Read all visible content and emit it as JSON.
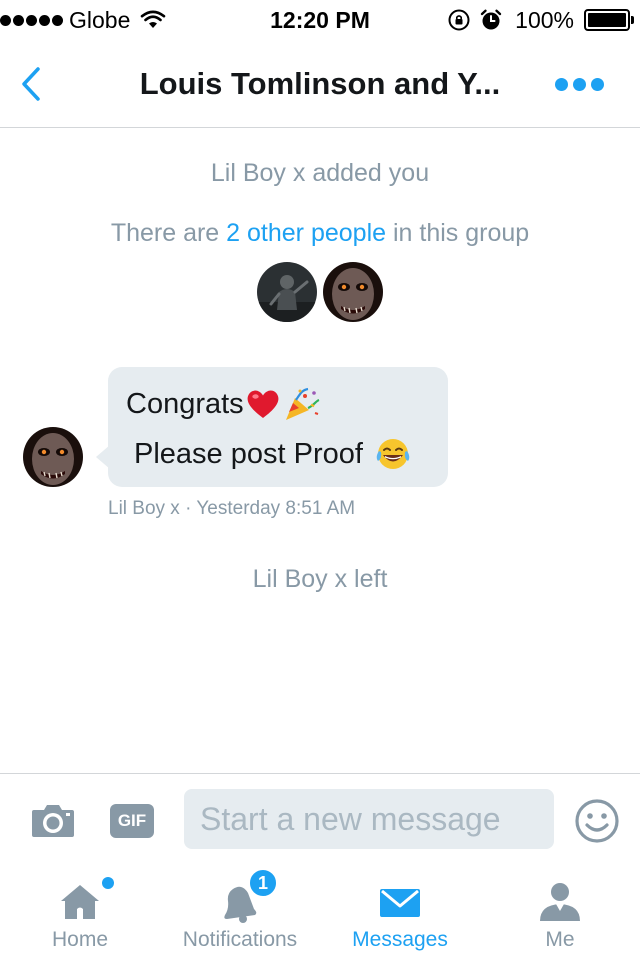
{
  "status_bar": {
    "carrier": "Globe",
    "time": "12:20 PM",
    "battery": "100%"
  },
  "header": {
    "title": "Louis Tomlinson and Y..."
  },
  "conversation": {
    "added_notice": "Lil Boy x added you",
    "group_info": {
      "prefix": "There are ",
      "link": "2 other people",
      "suffix": " in this group"
    },
    "message": {
      "line1": "Congrats",
      "line2": "Please post Proof",
      "meta": "Lil Boy x · Yesterday 8:51 AM"
    },
    "left_notice": "Lil Boy x left"
  },
  "composer": {
    "gif_label": "GIF",
    "placeholder": "Start a new message"
  },
  "tabs": [
    {
      "label": "Home"
    },
    {
      "label": "Notifications",
      "badge": "1"
    },
    {
      "label": "Messages"
    },
    {
      "label": "Me"
    }
  ],
  "colors": {
    "accent": "#1da1f2",
    "muted": "#8899a6",
    "bubble": "#e6ecf0"
  }
}
